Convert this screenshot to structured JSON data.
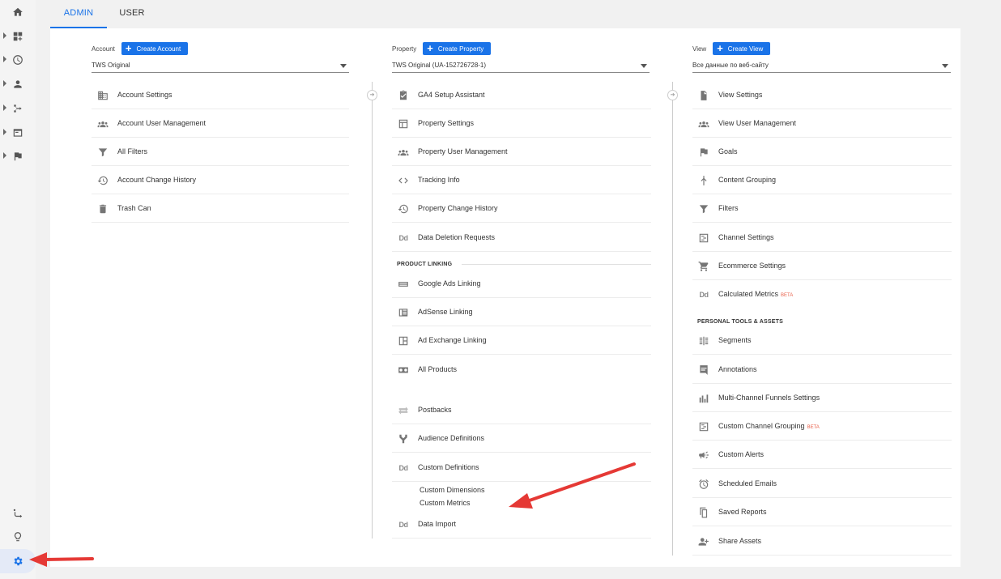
{
  "tabs": [
    {
      "label": "ADMIN",
      "active": true
    },
    {
      "label": "USER",
      "active": false
    }
  ],
  "sidebar": {
    "icons": [
      "home-icon",
      "dashboards-icon",
      "realtime-icon",
      "audience-icon",
      "acquisition-icon",
      "behavior-icon",
      "conversions-icon",
      "attribution-icon",
      "discover-icon",
      "admin-gear-icon"
    ]
  },
  "account": {
    "label": "Account",
    "create_label": "Create Account",
    "selected": "TWS Original",
    "items": [
      {
        "label": "Account Settings",
        "icon": "building-icon"
      },
      {
        "label": "Account User Management",
        "icon": "people-icon"
      },
      {
        "label": "All Filters",
        "icon": "filter-icon"
      },
      {
        "label": "Account Change History",
        "icon": "history-icon"
      },
      {
        "label": "Trash Can",
        "icon": "trash-icon"
      }
    ]
  },
  "property": {
    "label": "Property",
    "create_label": "Create Property",
    "selected": "TWS Original (UA-152726728-1)",
    "items": [
      {
        "label": "GA4 Setup Assistant",
        "icon": "checklist-icon"
      },
      {
        "label": "Property Settings",
        "icon": "layout-icon"
      },
      {
        "label": "Property User Management",
        "icon": "people-icon"
      },
      {
        "label": "Tracking Info",
        "icon": "code-icon"
      },
      {
        "label": "Property Change History",
        "icon": "history-icon"
      },
      {
        "label": "Data Deletion Requests",
        "icon": "dd-icon"
      }
    ],
    "product_linking_heading": "PRODUCT LINKING",
    "linking": [
      {
        "label": "Google Ads Linking",
        "icon": "ads-icon"
      },
      {
        "label": "AdSense Linking",
        "icon": "adsense-icon"
      },
      {
        "label": "Ad Exchange Linking",
        "icon": "adexchange-icon"
      },
      {
        "label": "All Products",
        "icon": "products-icon"
      }
    ],
    "more": [
      {
        "label": "Postbacks",
        "icon": "postbacks-icon"
      },
      {
        "label": "Audience Definitions",
        "icon": "audience-def-icon"
      },
      {
        "label": "Custom Definitions",
        "icon": "dd-icon"
      }
    ],
    "custom_sub": [
      "Custom Dimensions",
      "Custom Metrics"
    ],
    "data_import": {
      "label": "Data Import",
      "icon": "dd-icon"
    }
  },
  "view": {
    "label": "View",
    "create_label": "Create View",
    "selected": "Все данные по веб-сайту",
    "items": [
      {
        "label": "View Settings",
        "icon": "doc-icon"
      },
      {
        "label": "View User Management",
        "icon": "people-icon"
      },
      {
        "label": "Goals",
        "icon": "flag-icon"
      },
      {
        "label": "Content Grouping",
        "icon": "grouping-icon"
      },
      {
        "label": "Filters",
        "icon": "filter-icon"
      },
      {
        "label": "Channel Settings",
        "icon": "channel-icon"
      },
      {
        "label": "Ecommerce Settings",
        "icon": "cart-icon"
      },
      {
        "label": "Calculated Metrics",
        "icon": "dd-icon",
        "badge": "BETA"
      }
    ],
    "personal_heading": "PERSONAL TOOLS & ASSETS",
    "personal": [
      {
        "label": "Segments",
        "icon": "segments-icon"
      },
      {
        "label": "Annotations",
        "icon": "annotation-icon"
      },
      {
        "label": "Multi-Channel Funnels Settings",
        "icon": "bars-icon"
      },
      {
        "label": "Custom Channel Grouping",
        "icon": "channel-icon",
        "badge": "BETA"
      },
      {
        "label": "Custom Alerts",
        "icon": "megaphone-icon"
      },
      {
        "label": "Scheduled Emails",
        "icon": "clock-icon"
      },
      {
        "label": "Saved Reports",
        "icon": "saved-icon"
      },
      {
        "label": "Share Assets",
        "icon": "share-icon"
      }
    ]
  },
  "colors": {
    "accent": "#1a73e8",
    "annotation_arrow": "#e53935",
    "beta": "#e8624c"
  }
}
